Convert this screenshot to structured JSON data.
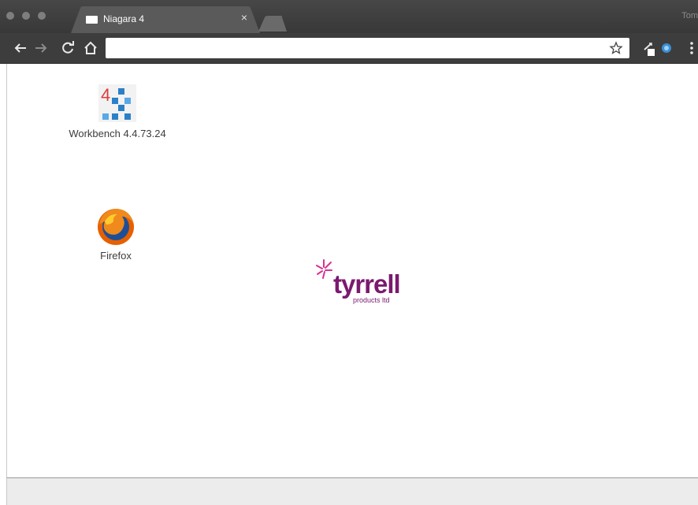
{
  "browser": {
    "tab": {
      "title": "Niagara 4",
      "close_glyph": "×"
    },
    "profile_name": "Tom",
    "omnibox": {
      "value": "",
      "placeholder": ""
    },
    "icons": [
      "back-icon",
      "forward-icon",
      "reload-icon",
      "home-icon",
      "bookmark-star-icon",
      "extension-icon",
      "sync-icon",
      "menu-icon"
    ]
  },
  "desktop": {
    "icons": [
      {
        "label": "Workbench 4.4.73.24",
        "icon": "niagara-workbench-icon",
        "glyph": "4"
      },
      {
        "label": "Firefox",
        "icon": "firefox-icon"
      }
    ]
  },
  "logo": {
    "word": "tyrrell",
    "sub": "products ltd"
  },
  "colors": {
    "chrome_dark": "#3d3d3d",
    "tab_active": "#5a5a5a",
    "logo_purple": "#7a1a6e",
    "logo_pink": "#d6338f",
    "workbench_red": "#e03a3a",
    "workbench_blue": "#2a80c8"
  }
}
